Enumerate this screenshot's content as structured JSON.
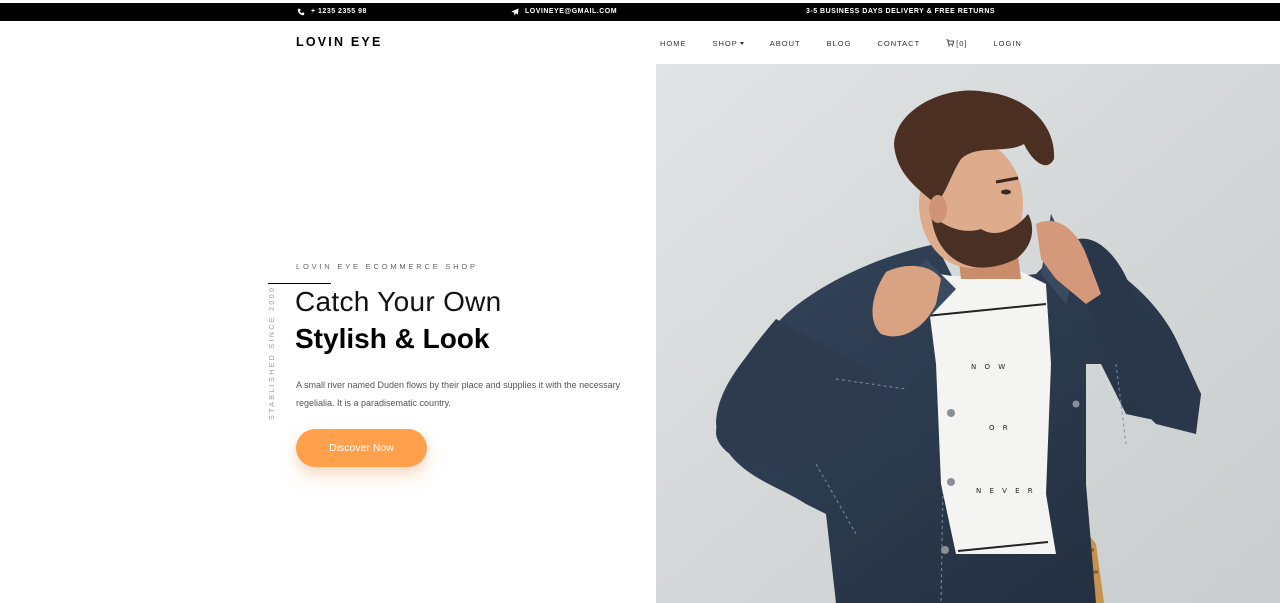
{
  "topbar": {
    "phone": "+ 1235 2355 98",
    "email": "LOVINEYE@GMAIL.COM",
    "shipping": "3-5 BUSINESS DAYS DELIVERY & FREE RETURNS",
    "icons": {
      "phone": "phone-icon",
      "email": "paper-plane-icon"
    }
  },
  "header": {
    "logo": "LOVIN EYE",
    "nav": {
      "home": "HOME",
      "shop": "SHOP",
      "about": "ABOUT",
      "blog": "BLOG",
      "contact": "CONTACT",
      "cart": "[0]",
      "login": "LOGIN"
    },
    "icons": {
      "shop_dropdown": "caret-down-icon",
      "cart": "cart-icon"
    }
  },
  "hero": {
    "vertical_text": "STABLISHED SINCE 2000",
    "subtitle": "LOVIN EYE ECOMMERCE SHOP",
    "title_light": "Catch Your Own",
    "title_bold": "Stylish & Look",
    "description": "A small river named Duden flows by their place and supplies it with the necessary regelialia. It is a paradisematic country.",
    "cta": "Discover Now",
    "tshirt_print": [
      "N O W",
      "O R",
      "N E V E R"
    ]
  },
  "colors": {
    "topbar_bg": "#000000",
    "accent": "#ffa04d",
    "photo_bg": "#d7dadb",
    "denim": "#2b3a4e"
  }
}
